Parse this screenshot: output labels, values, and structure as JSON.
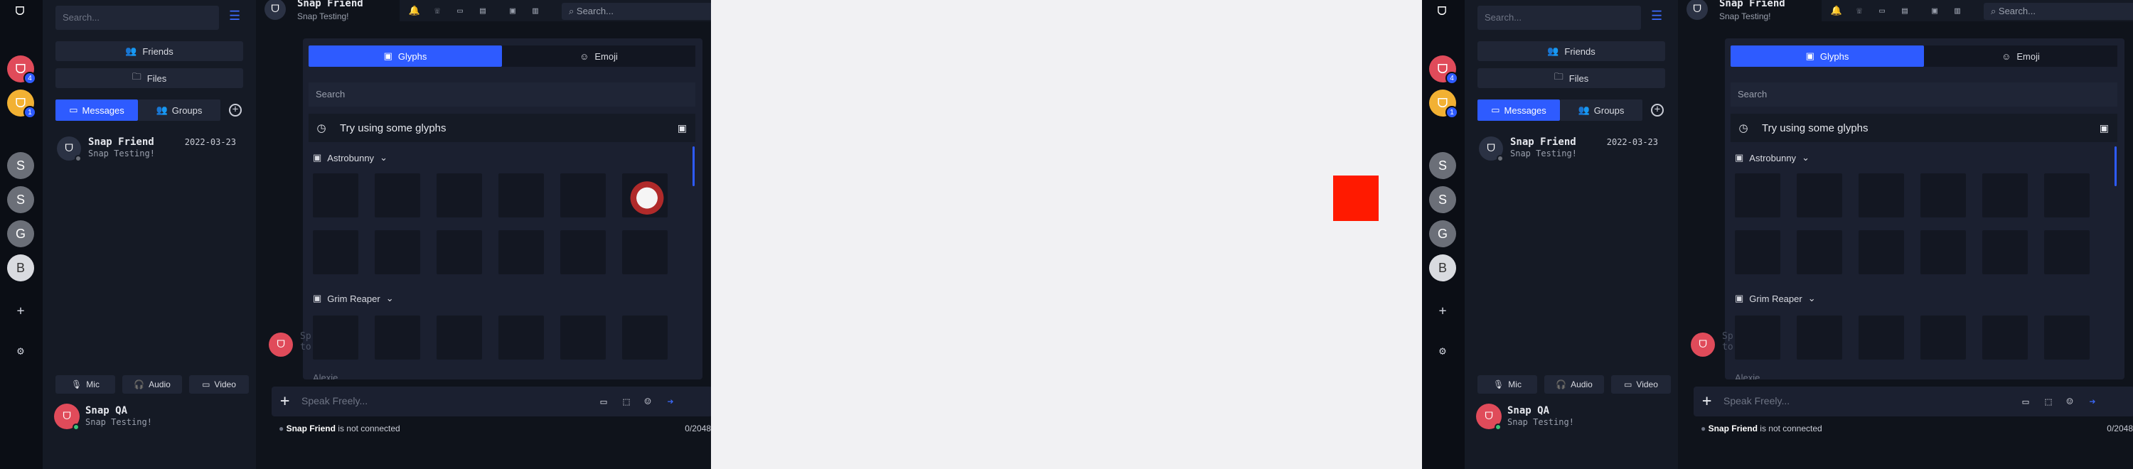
{
  "rail": {
    "logo": "ᗜ",
    "servers": [
      {
        "letter": "ᗜ",
        "color": "#e04b5a",
        "badge": "4"
      },
      {
        "letter": "ᗜ",
        "color": "#f2b133",
        "badge": "1"
      },
      {
        "letter": "S",
        "color": "#6b6f78",
        "badge": ""
      },
      {
        "letter": "S",
        "color": "#6b6f78",
        "badge": ""
      },
      {
        "letter": "G",
        "color": "#6b6f78",
        "badge": ""
      },
      {
        "letter": "B",
        "color": "#d9dbe0",
        "badge": ""
      }
    ],
    "add_label": "+",
    "settings_label": "⚙"
  },
  "sidebar": {
    "search_placeholder": "Search...",
    "friends_label": "Friends",
    "files_label": "Files",
    "messages_tab": "Messages",
    "groups_tab": "Groups",
    "chat": {
      "name": "Snap Friend",
      "date": "2022-03-23",
      "message": "Snap Testing!"
    },
    "controls": {
      "mic": "Mic",
      "audio": "Audio",
      "video": "Video"
    },
    "me": {
      "name": "Snap QA",
      "message": "Snap Testing!"
    }
  },
  "header": {
    "name": "Snap Friend",
    "status": "Snap Testing!",
    "search_placeholder": "Search..."
  },
  "picker": {
    "glyphs_tab": "Glyphs",
    "emoji_tab": "Emoji",
    "search_placeholder": "Search",
    "recent_text": "Try using some glyphs",
    "packs": [
      "Astrobunny",
      "Grim Reaper"
    ],
    "partial_pack_text": "Alexie ..."
  },
  "composer": {
    "placeholder": "Speak Freely...",
    "partial_message": "Sp to"
  },
  "footer": {
    "name": "Snap Friend",
    "status_text": "is not connected",
    "counter": "0/2048"
  },
  "colors": {
    "accent": "#2e5bff",
    "background": "#0f131b",
    "panel": "#151a25",
    "online": "#3bc47a"
  }
}
